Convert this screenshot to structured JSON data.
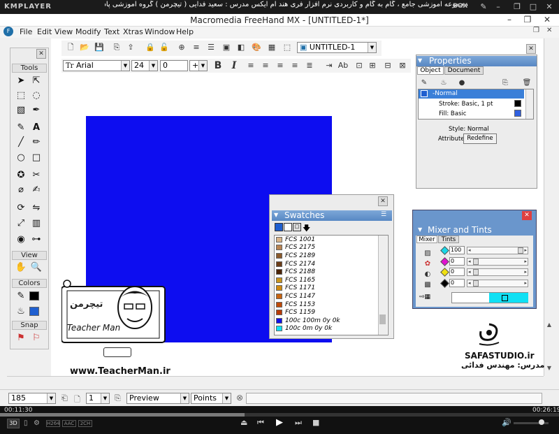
{
  "player": {
    "logo": "KMPLAYER",
    "caption": "مجموعه آموزشی جامع ، گام به گام و کاربردی نرم افزار فری هند ام ایکس   مدرس : سعید فدایی ( تیچرمن ) گروه آموزشی پادشاه گرافیست ها",
    "box_label": "BOX",
    "time_elapsed": "00:11:30",
    "time_total": "00:26:19",
    "badges": [
      "H264",
      "AAC",
      "2CH"
    ],
    "progress": 0.437,
    "volume": 0.8
  },
  "app": {
    "title": "Macromedia FreeHand MX - [UNTITLED-1*]",
    "menus": [
      "File",
      "Edit",
      "View",
      "Modify",
      "Text",
      "Xtras",
      "Window",
      "Help"
    ],
    "document_selector": "UNTITLED-1"
  },
  "text_toolbar": {
    "font": "Arial",
    "size": "24",
    "leading": "0"
  },
  "tools_panel": {
    "tools_header": "Tools",
    "view_header": "View",
    "colors_header": "Colors",
    "snap_header": "Snap"
  },
  "properties": {
    "title": "Properties",
    "tabs": [
      "Object",
      "Document"
    ],
    "rows": [
      "Normal",
      "Stroke: Basic, 1 pt",
      "Fill: Basic"
    ],
    "style_label": "Style: Normal",
    "attributes_label": "Attributes:",
    "redefine_button": "Redefine"
  },
  "swatches": {
    "title": "Swatches",
    "items": [
      {
        "name": "FCS 1001",
        "color": "#d8b58a"
      },
      {
        "name": "FCS 2175",
        "color": "#b88452"
      },
      {
        "name": "FCS 2189",
        "color": "#8a5a2c"
      },
      {
        "name": "FCS 2174",
        "color": "#6b3d18"
      },
      {
        "name": "FCS 2188",
        "color": "#4a2408"
      },
      {
        "name": "FCS 1165",
        "color": "#c9951e"
      },
      {
        "name": "FCS 1171",
        "color": "#d08a10"
      },
      {
        "name": "FCS 1147",
        "color": "#c86410"
      },
      {
        "name": "FCS 1153",
        "color": "#c04a08"
      },
      {
        "name": "FCS 1159",
        "color": "#b83a04"
      },
      {
        "name": "100c 100m 0y 0k",
        "color": "#1010e8"
      },
      {
        "name": "100c 0m 0y 0k",
        "color": "#10e0f4"
      }
    ]
  },
  "mixer": {
    "title": "Mixer and Tints",
    "tabs": [
      "Mixer",
      "Tints"
    ],
    "channels": [
      {
        "label": "c",
        "value": "100",
        "color": "#18d8e8"
      },
      {
        "label": "m",
        "value": "0",
        "color": "#e010d0"
      },
      {
        "label": "y",
        "value": "0",
        "color": "#f0e010"
      },
      {
        "label": "k",
        "value": "0",
        "color": "#000000"
      }
    ],
    "preview_color": "#10e0f4"
  },
  "statusbar": {
    "zoom": "185",
    "page": "1",
    "view_mode": "Preview",
    "units": "Points"
  },
  "watermark": {
    "teacher_name": "Teacher Man",
    "logo_text": "تیچرمن",
    "url": "www.TeacherMan.ir",
    "studio": "SAFASTUDIO.ir",
    "instructor": "مدرس: مهندس فدائی"
  },
  "colors": {
    "accent_blue": "#0d0df0",
    "panel_header": "#6a96cc"
  }
}
